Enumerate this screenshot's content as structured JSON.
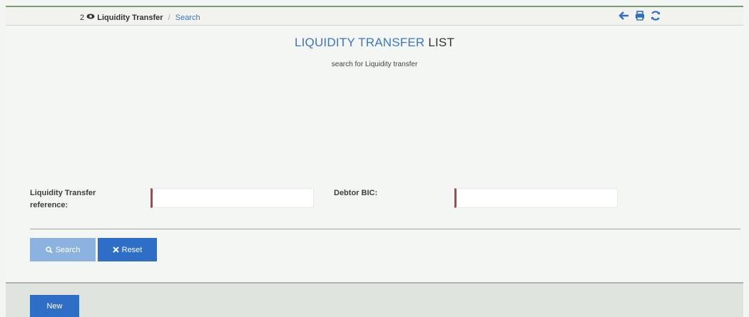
{
  "breadcrumb": {
    "count": "2",
    "current": "Liquidity Transfer",
    "separator": "/",
    "link": "Search"
  },
  "toolbar": [
    "back-arrow-icon",
    "print-icon",
    "refresh-icon"
  ],
  "header": {
    "title_blue": "LIQUIDITY TRANSFER",
    "title_dark": "LIST",
    "subtitle": "search for Liquidity transfer"
  },
  "form": {
    "reference_label_line1": "Liquidity Transfer",
    "reference_label_line2": "reference:",
    "reference_value": "",
    "debtor_bic_label": "Debtor BIC:",
    "debtor_bic_value": ""
  },
  "buttons": {
    "search": "Search",
    "reset": "Reset",
    "new": "New"
  },
  "colors": {
    "accent": "#3b76c4",
    "primary_button": "#2f6ec7",
    "disabled_button": "#8cb3e0",
    "required_marker": "#b8404a"
  }
}
